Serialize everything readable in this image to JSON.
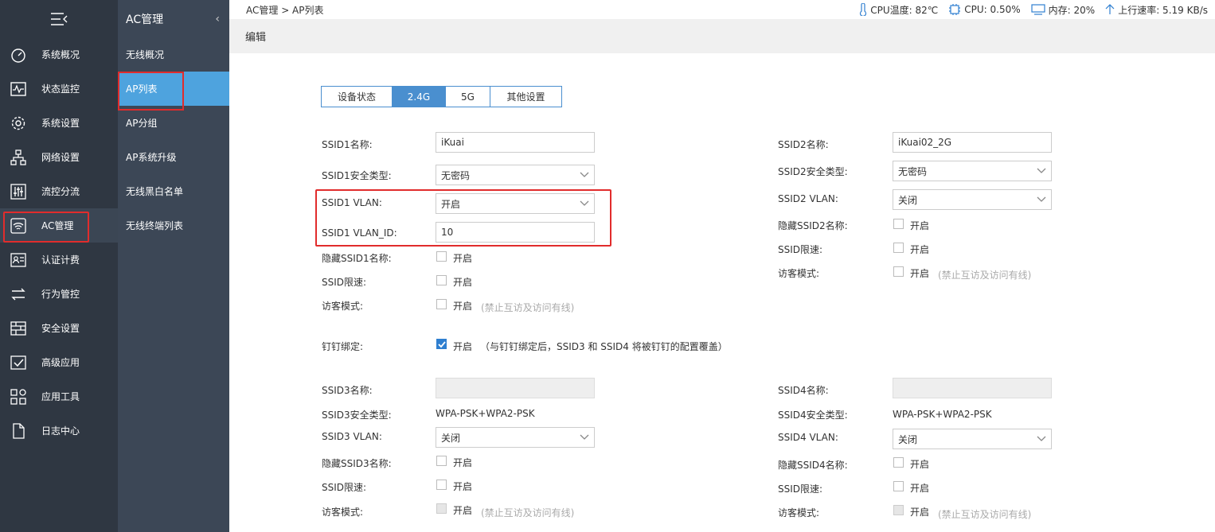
{
  "sidebar": {
    "items": [
      {
        "label": "系统概况",
        "icon": "dashboard-icon"
      },
      {
        "label": "状态监控",
        "icon": "pulse-icon"
      },
      {
        "label": "系统设置",
        "icon": "gear-icon"
      },
      {
        "label": "网络设置",
        "icon": "network-icon"
      },
      {
        "label": "流控分流",
        "icon": "sliders-icon"
      },
      {
        "label": "AC管理",
        "icon": "wifi-icon"
      },
      {
        "label": "认证计费",
        "icon": "id-card-icon"
      },
      {
        "label": "行为管控",
        "icon": "arrows-icon"
      },
      {
        "label": "安全设置",
        "icon": "firewall-icon"
      },
      {
        "label": "高级应用",
        "icon": "check-board-icon"
      },
      {
        "label": "应用工具",
        "icon": "apps-icon"
      },
      {
        "label": "日志中心",
        "icon": "document-icon"
      }
    ]
  },
  "submenu": {
    "title": "AC管理",
    "items": [
      "无线概况",
      "AP列表",
      "AP分组",
      "AP系统升级",
      "无线黑白名单",
      "无线终端列表"
    ]
  },
  "topbar": {
    "breadcrumb": "AC管理 > AP列表",
    "cpu_temp": "CPU温度: 82℃",
    "cpu": "CPU: 0.50%",
    "mem": "内存: 20%",
    "upload": "上行速率: 5.19 KB/s"
  },
  "edit_title": "编辑",
  "tabs": [
    "设备状态",
    "2.4G",
    "5G",
    "其他设置"
  ],
  "form": {
    "ssid1_name_label": "SSID1名称:",
    "ssid1_name_value": "iKuai",
    "ssid1_sec_label": "SSID1安全类型:",
    "ssid1_sec_value": "无密码",
    "ssid1_vlan_label": "SSID1 VLAN:",
    "ssid1_vlan_value": "开启",
    "ssid1_vlanid_label": "SSID1 VLAN_ID:",
    "ssid1_vlanid_value": "10",
    "hide_ssid1_label": "隐藏SSID1名称:",
    "ssid_limit_label": "SSID限速:",
    "guest_label": "访客模式:",
    "on_text": "开启",
    "guest_hint": "(禁止互访及访问有线)",
    "ssid2_name_label": "SSID2名称:",
    "ssid2_name_value": "iKuai02_2G",
    "ssid2_sec_label": "SSID2安全类型:",
    "ssid2_sec_value": "无密码",
    "ssid2_vlan_label": "SSID2 VLAN:",
    "ssid2_vlan_value": "关闭",
    "hide_ssid2_label": "隐藏SSID2名称:",
    "dingtalk_label": "钉钉绑定:",
    "dingtalk_hint": "（与钉钉绑定后，SSID3 和 SSID4 将被钉钉的配置覆盖）",
    "ssid3_name_label": "SSID3名称:",
    "ssid3_sec_label": "SSID3安全类型:",
    "ssid3_sec_value": "WPA-PSK+WPA2-PSK",
    "ssid3_vlan_label": "SSID3 VLAN:",
    "ssid3_vlan_value": "关闭",
    "hide_ssid3_label": "隐藏SSID3名称:",
    "ssid4_name_label": "SSID4名称:",
    "ssid4_sec_label": "SSID4安全类型:",
    "ssid4_sec_value": "WPA-PSK+WPA2-PSK",
    "ssid4_vlan_label": "SSID4 VLAN:",
    "ssid4_vlan_value": "关闭",
    "hide_ssid4_label": "隐藏SSID4名称:"
  },
  "colors": {
    "accent": "#4a8fcf",
    "sidebar": "#2f3742",
    "highlight": "#e12c2c"
  }
}
